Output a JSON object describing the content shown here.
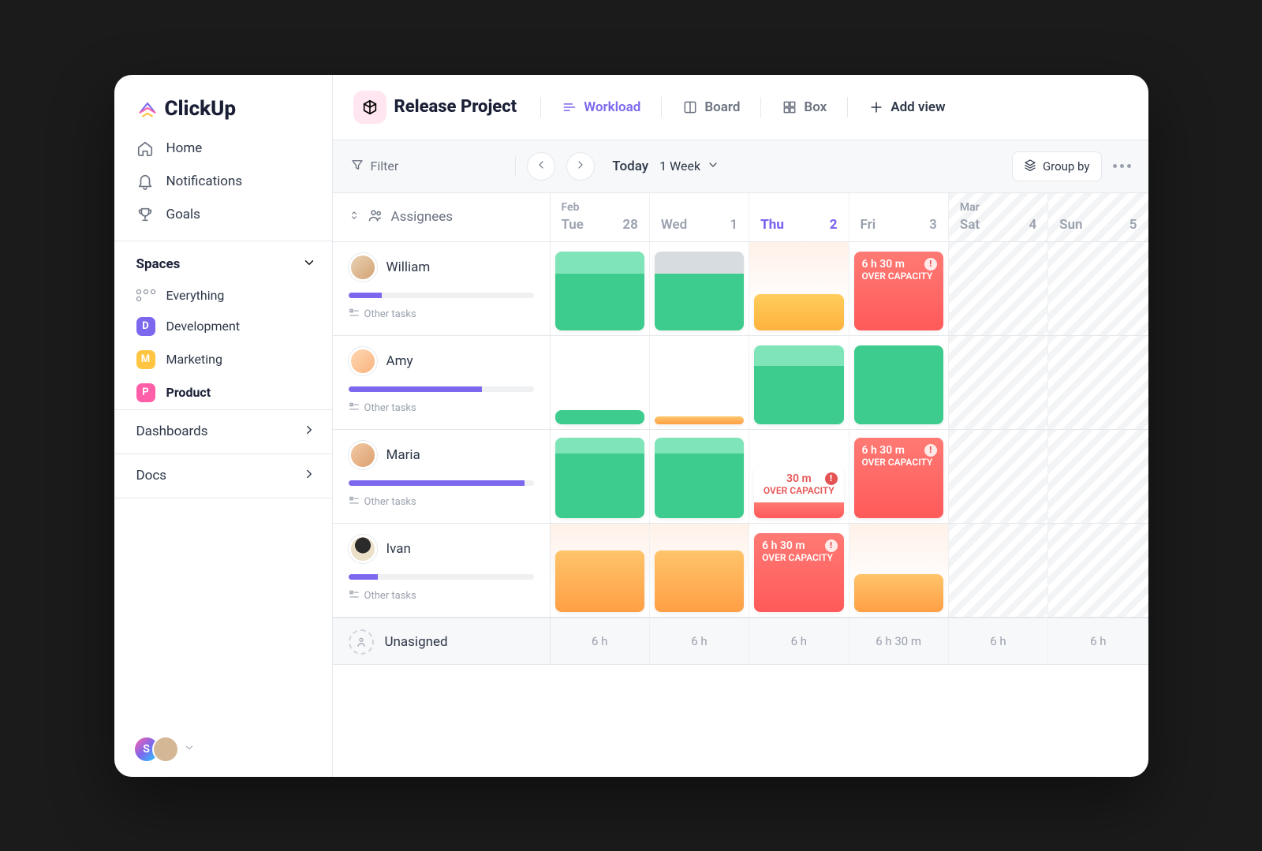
{
  "brand": {
    "name": "ClickUp"
  },
  "sidebar": {
    "nav": [
      {
        "label": "Home"
      },
      {
        "label": "Notifications"
      },
      {
        "label": "Goals"
      }
    ],
    "spaces_header": "Spaces",
    "everything_label": "Everything",
    "spaces": [
      {
        "initial": "D",
        "label": "Development",
        "color": "#7B68EE",
        "active": false
      },
      {
        "initial": "M",
        "label": "Marketing",
        "color": "#FFC542",
        "active": false
      },
      {
        "initial": "P",
        "label": "Product",
        "color": "#FF5FA8",
        "active": true
      }
    ],
    "sections": [
      {
        "label": "Dashboards"
      },
      {
        "label": "Docs"
      }
    ],
    "avatar_initial": "S"
  },
  "header": {
    "project_title": "Release Project",
    "views": [
      {
        "label": "Workload",
        "active": true
      },
      {
        "label": "Board",
        "active": false
      },
      {
        "label": "Box",
        "active": false
      }
    ],
    "add_view_label": "Add view"
  },
  "toolbar": {
    "filter_label": "Filter",
    "today_label": "Today",
    "range_label": "1 Week",
    "groupby_label": "Group by"
  },
  "grid": {
    "assignees_label": "Assignees",
    "days": [
      {
        "month": "Feb",
        "dow": "Tue",
        "num": "28",
        "today": false,
        "weekend": false
      },
      {
        "month": "",
        "dow": "Wed",
        "num": "1",
        "today": false,
        "weekend": false
      },
      {
        "month": "",
        "dow": "Thu",
        "num": "2",
        "today": true,
        "weekend": false
      },
      {
        "month": "",
        "dow": "Fri",
        "num": "3",
        "today": false,
        "weekend": false
      },
      {
        "month": "Mar",
        "dow": "Sat",
        "num": "4",
        "today": false,
        "weekend": true
      },
      {
        "month": "",
        "dow": "Sun",
        "num": "5",
        "today": false,
        "weekend": true
      }
    ],
    "other_tasks_label": "Other tasks",
    "overcap_time": "6 h 30 m",
    "overcap_label": "OVER CAPACITY",
    "short_time": "30 m",
    "rows": [
      {
        "name": "William",
        "progress_pct": 18
      },
      {
        "name": "Amy",
        "progress_pct": 72
      },
      {
        "name": "Maria",
        "progress_pct": 95
      },
      {
        "name": "Ivan",
        "progress_pct": 16
      }
    ],
    "unassigned_label": "Unasigned",
    "footer_totals": [
      "6 h",
      "6 h",
      "6 h",
      "6 h 30 m",
      "6 h",
      "6 h"
    ]
  }
}
